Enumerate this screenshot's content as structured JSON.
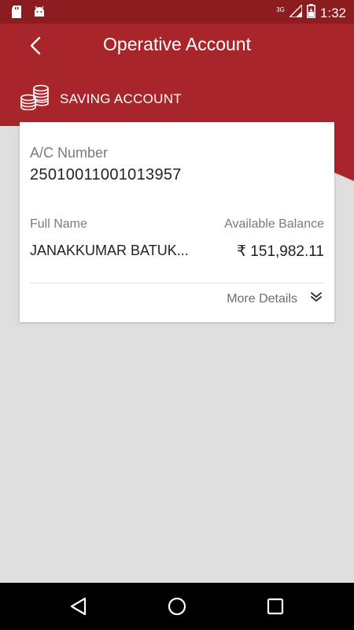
{
  "status_bar": {
    "time": "1:32",
    "network": "3G",
    "icons": [
      "sd-card-icon",
      "android-icon",
      "signal-icon",
      "battery-icon"
    ]
  },
  "header": {
    "title": "Operative Account",
    "back_icon": "back-arrow-icon"
  },
  "account_type": {
    "label": "SAVING ACCOUNT",
    "icon": "coins-icon"
  },
  "card": {
    "acno_label": "A/C Number",
    "acno_value": "25010011001013957",
    "name_label": "Full Name",
    "name_value": "JANAKKUMAR BATUK...",
    "balance_label": "Available Balance",
    "balance_value": "₹ 151,982.11",
    "more_label": "More Details",
    "more_icon": "double-chevron-down-icon"
  },
  "nav": {
    "back": "back-triangle-icon",
    "home": "home-circle-icon",
    "recents": "recents-square-icon"
  },
  "colors": {
    "brand_red": "#a8252b",
    "status_red": "#8b1c20",
    "background": "#dedede"
  }
}
